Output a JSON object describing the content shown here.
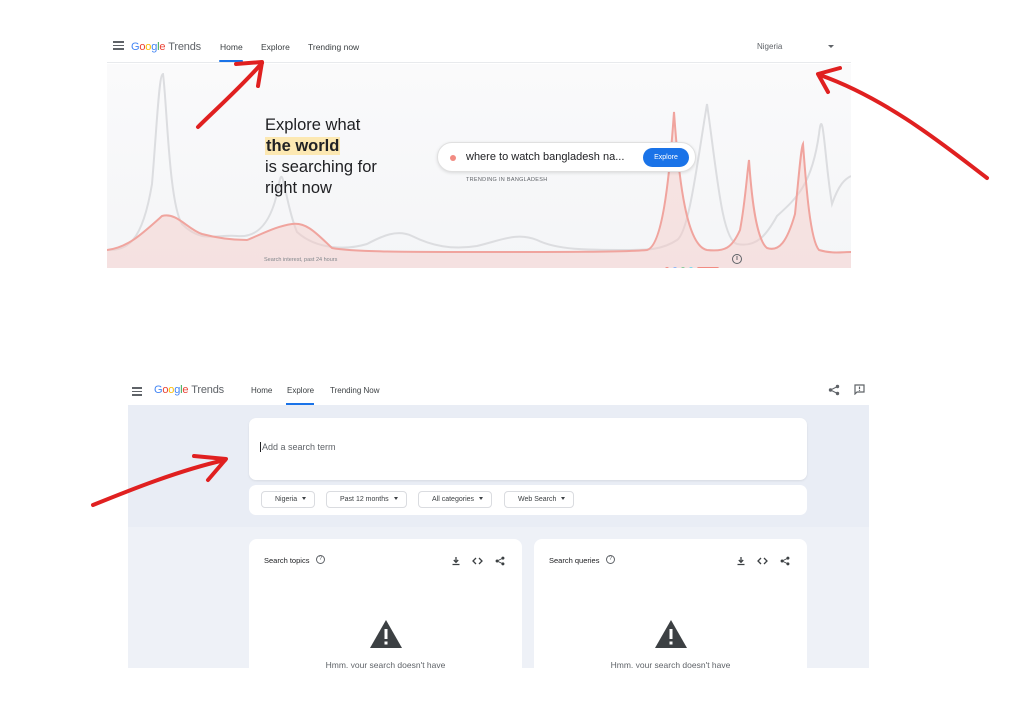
{
  "top_screen": {
    "logo": {
      "google": "Google",
      "trends": "Trends"
    },
    "nav": {
      "home": "Home",
      "explore": "Explore",
      "trending_now": "Trending now"
    },
    "country": "Nigeria",
    "headline": {
      "line1": "Explore what",
      "highlight": "the world",
      "line3": "is searching for",
      "line4": "right now"
    },
    "search_query": "where to watch bangladesh na...",
    "explore_button": "Explore",
    "trending_label": "TRENDING IN BANGLADESH",
    "footnote": "Search interest, past 24 hours",
    "carousel_colors": [
      "#f28b82",
      "#8ab4f8",
      "#81c995",
      "#78d9ec"
    ],
    "accent": "#1a73e8"
  },
  "bottom_screen": {
    "logo": {
      "google": "Google",
      "trends": "Trends"
    },
    "nav": {
      "home": "Home",
      "explore": "Explore",
      "trending_now": "Trending Now"
    },
    "icons": [
      "share-icon",
      "feedback-icon"
    ],
    "search": {
      "placeholder": "Add a search term",
      "value": ""
    },
    "filters": {
      "region": "Nigeria",
      "time": "Past 12 months",
      "category": "All categories",
      "property": "Web Search"
    },
    "cards": [
      {
        "title": "Search topics",
        "message": "Hmm, your search doesn't have"
      },
      {
        "title": "Search queries",
        "message": "Hmm, your search doesn't have"
      }
    ],
    "card_icons": [
      "download-icon",
      "embed-icon",
      "share-icon"
    ]
  }
}
